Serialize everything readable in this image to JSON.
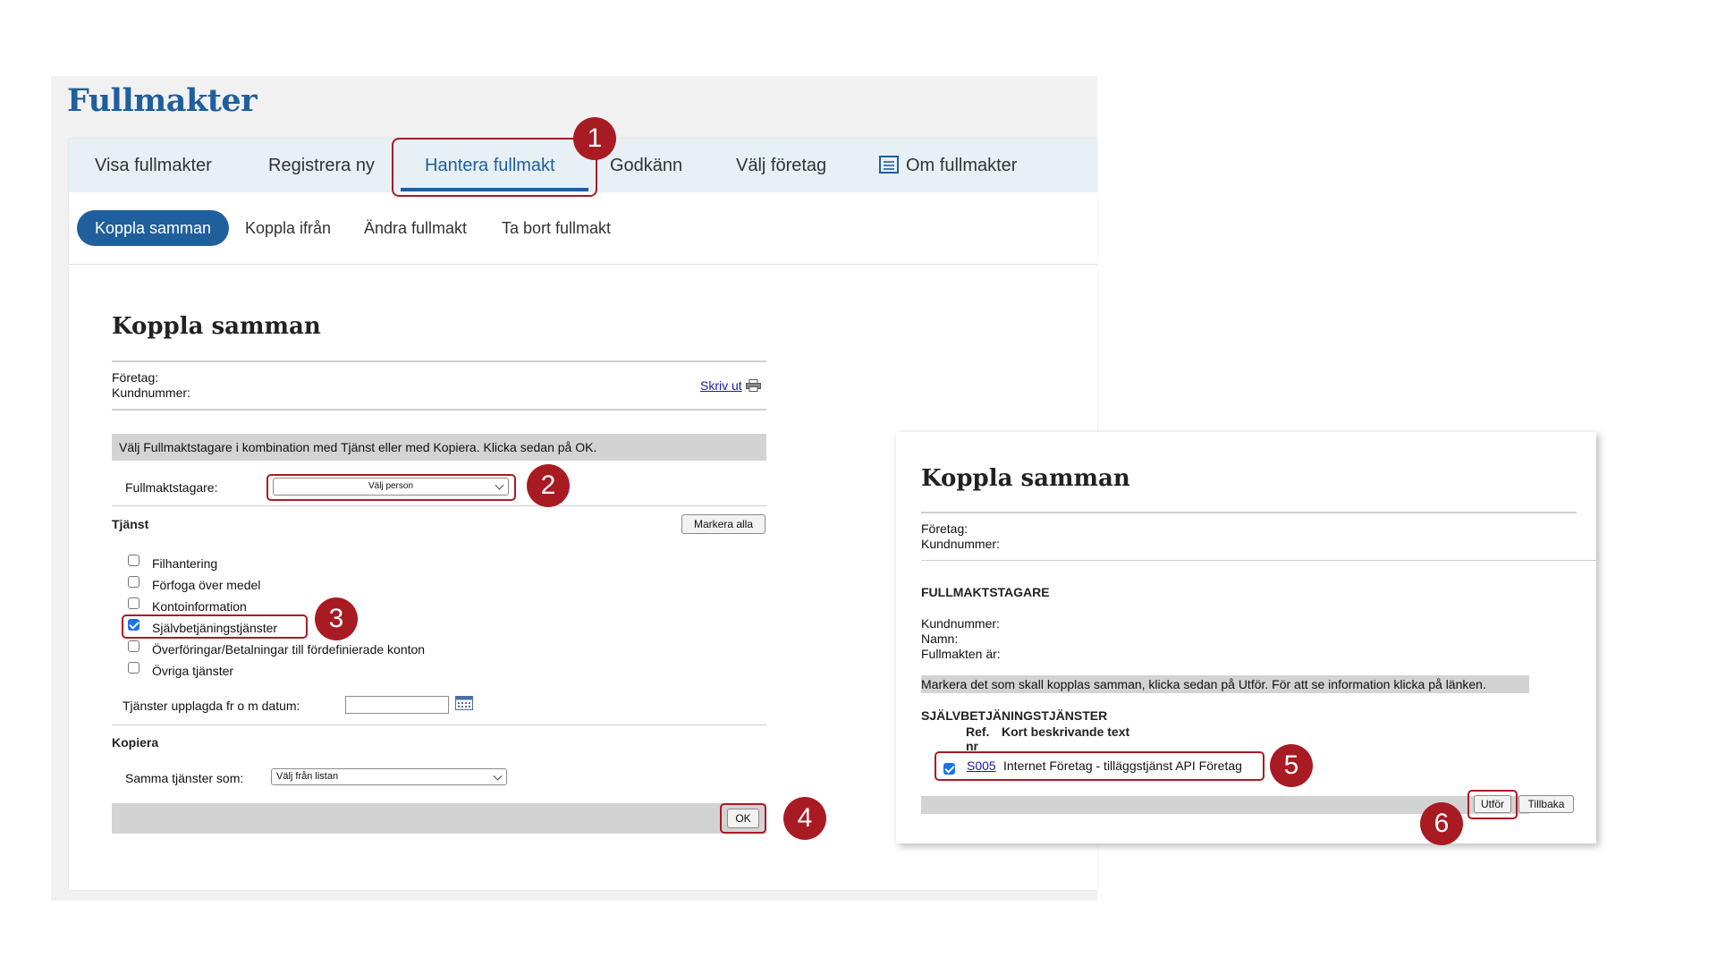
{
  "app_title": "Fullmakter",
  "main_tabs": [
    {
      "label": "Visa fullmakter"
    },
    {
      "label": "Registrera ny"
    },
    {
      "label": "Hantera fullmakt"
    },
    {
      "label": "Godkänn"
    },
    {
      "label": "Välj företag"
    },
    {
      "label": "Om fullmakter"
    }
  ],
  "sub_tabs": [
    {
      "label": "Koppla samman"
    },
    {
      "label": "Koppla ifrån"
    },
    {
      "label": "Ändra fullmakt"
    },
    {
      "label": "Ta bort fullmakt"
    }
  ],
  "form": {
    "heading": "Koppla samman",
    "foretag_label": "Företag:",
    "kundnummer_label": "Kundnummer:",
    "print_link": "Skriv ut",
    "instruction": "Välj Fullmaktstagare i kombination med Tjänst eller med Kopiera. Klicka sedan på OK.",
    "fullmaktstagare_label": "Fullmaktstagare:",
    "fullmaktstagare_value": "Välj person",
    "tjanst_heading": "Tjänst",
    "markera_alla": "Markera alla",
    "services": [
      {
        "label": "Filhantering",
        "checked": false
      },
      {
        "label": "Förfoga över medel",
        "checked": false
      },
      {
        "label": "Kontoinformation",
        "checked": false
      },
      {
        "label": "Självbetjäningstjänster",
        "checked": true
      },
      {
        "label": "Överföringar/Betalningar till fördefinierade konton",
        "checked": false
      },
      {
        "label": "Övriga tjänster",
        "checked": false
      }
    ],
    "date_label": "Tjänster upplagda fr o m datum:",
    "date_value": "",
    "kopiera_heading": "Kopiera",
    "samma_label": "Samma tjänster som:",
    "samma_value": "Välj från listan",
    "ok_button": "OK"
  },
  "confirm": {
    "heading": "Koppla samman",
    "foretag_label": "Företag:",
    "kundnummer_label": "Kundnummer:",
    "section_title": "FULLMAKTSTAGARE",
    "kundnummer2_label": "Kundnummer:",
    "namn_label": "Namn:",
    "fullmakten_label": "Fullmakten är:",
    "instruction": "Markera det som skall kopplas samman, klicka sedan på Utför. För att se information klicka på länken.",
    "service_title": "SJÄLVBETJÄNINGSTJÄNSTER",
    "col_ref": "Ref. nr",
    "col_desc": "Kort beskrivande text",
    "row_ref": "S005",
    "row_desc": "Internet Företag - tilläggstjänst API Företag",
    "utfor_button": "Utför",
    "tillbaka_button": "Tillbaka"
  },
  "callouts": {
    "one": "1",
    "two": "2",
    "three": "3",
    "four": "4",
    "five": "5",
    "six": "6"
  },
  "colors": {
    "brand": "#1f5f9c",
    "callout": "#a91b23",
    "nav_bg": "#e7f0f5",
    "checkbox": "#1a73e8"
  },
  "icons": [
    "printer-icon",
    "list-document-icon",
    "calendar-icon",
    "chevron-down-icon",
    "checkmark-icon"
  ]
}
